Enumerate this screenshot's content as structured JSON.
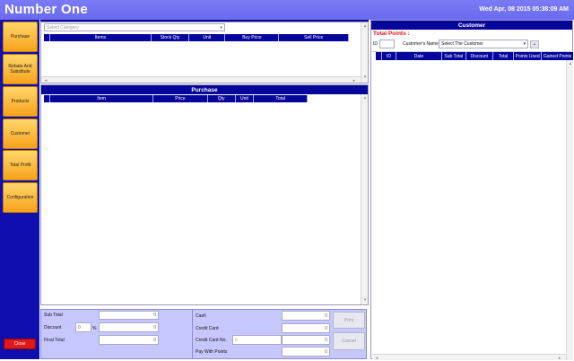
{
  "header": {
    "title": "Number One",
    "datetime": "Wed Apr, 08 2015 05:38:09 AM"
  },
  "sidebar": {
    "items": [
      {
        "label": "Purchase"
      },
      {
        "label": "Rebate And Substitute"
      },
      {
        "label": "Products"
      },
      {
        "label": "Customer"
      },
      {
        "label": "Total Profit"
      },
      {
        "label": "Configuration"
      }
    ],
    "close_label": "Close"
  },
  "products": {
    "category_placeholder": "Select Category",
    "columns": [
      "Items",
      "Stock Qty",
      "Unit",
      "Buy Price",
      "Sell Price"
    ]
  },
  "purchase": {
    "title": "Purchase",
    "columns": [
      "Item",
      "Price",
      "Qty",
      "Unit",
      "Total"
    ]
  },
  "totals": {
    "sub_total_label": "Sub Total",
    "sub_total": "0",
    "discount_label": "Discount",
    "discount_pct": "0",
    "percent_sign": "%",
    "discount_value": "0",
    "final_total_label": "Final Total",
    "final_total": "0"
  },
  "payment": {
    "cash_label": "Cash",
    "cash": "0",
    "credit_card_label": "Credit Card",
    "credit_card": "0",
    "credit_card_no_label": "Credit Card No.",
    "credit_card_no": "0",
    "credit_card_no_value": "0",
    "pay_points_label": "Pay With Points",
    "pay_points": "0",
    "print_label": "Print",
    "cancel_label": "Cancel"
  },
  "customer": {
    "title": "Customer",
    "total_points_label": "Total Points :",
    "id_label": "ID",
    "name_label": "Customer's Name",
    "name_select": "Select The Customer",
    "add_label": "+",
    "columns": [
      "ID",
      "Date",
      "Sub Total",
      "Discount",
      "Total",
      "Points Used",
      "Gained Points"
    ]
  },
  "colors": {
    "header": "#6a6af0",
    "sidebar": "#0f0fb0",
    "nav_button": "#f7a21a",
    "close": "#e01818",
    "table_header": "#06069a",
    "points_label": "#e01818"
  }
}
